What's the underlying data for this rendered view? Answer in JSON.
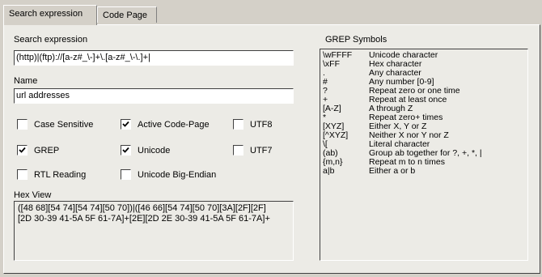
{
  "tabs": [
    {
      "label": "Search expression"
    },
    {
      "label": "Code Page"
    }
  ],
  "search": {
    "label": "Search expression",
    "value": "(http)|(ftp)://[a-z#_\\-]+\\.[a-z#_\\-\\.]+|"
  },
  "name": {
    "label": "Name",
    "value": "url addresses"
  },
  "options": {
    "case_sensitive": {
      "label": "Case Sensitive",
      "checked": false
    },
    "active_code_page": {
      "label": "Active Code-Page",
      "checked": true
    },
    "utf8": {
      "label": "UTF8",
      "checked": false
    },
    "grep": {
      "label": "GREP",
      "checked": true
    },
    "unicode": {
      "label": "Unicode",
      "checked": true
    },
    "utf7": {
      "label": "UTF7",
      "checked": false
    },
    "rtl_reading": {
      "label": "RTL Reading",
      "checked": false
    },
    "unicode_big_endian": {
      "label": "Unicode Big-Endian",
      "checked": false
    }
  },
  "hex_view": {
    "label": "Hex View",
    "lines": [
      "([48 68][54 74][54 74][50 70])|([46 66][54 74][50 70][3A][2F][2F]",
      "[2D 30-39 41-5A 5F 61-7A]+[2E][2D 2E 30-39 41-5A 5F 61-7A]+"
    ]
  },
  "grep_symbols": {
    "label": "GREP Symbols",
    "items": [
      {
        "symbol": "\\wFFFF",
        "desc": "Unicode character"
      },
      {
        "symbol": "\\xFF",
        "desc": "Hex character"
      },
      {
        "symbol": ".",
        "desc": "Any character"
      },
      {
        "symbol": "#",
        "desc": "Any number [0-9]"
      },
      {
        "symbol": "?",
        "desc": "Repeat zero or one time"
      },
      {
        "symbol": "+",
        "desc": "Repeat at least once"
      },
      {
        "symbol": "[A-Z]",
        "desc": "A through Z"
      },
      {
        "symbol": "*",
        "desc": "Repeat zero+ times"
      },
      {
        "symbol": "[XYZ]",
        "desc": "Either X, Y or Z"
      },
      {
        "symbol": "[^XYZ]",
        "desc": "Neither X nor Y nor Z"
      },
      {
        "symbol": "\\[",
        "desc": "Literal character"
      },
      {
        "symbol": "(ab)",
        "desc": "Group ab together for ?, +, *, |"
      },
      {
        "symbol": "{m,n}",
        "desc": "Repeat m to n times"
      },
      {
        "symbol": "a|b",
        "desc": "Either a or b"
      }
    ]
  }
}
